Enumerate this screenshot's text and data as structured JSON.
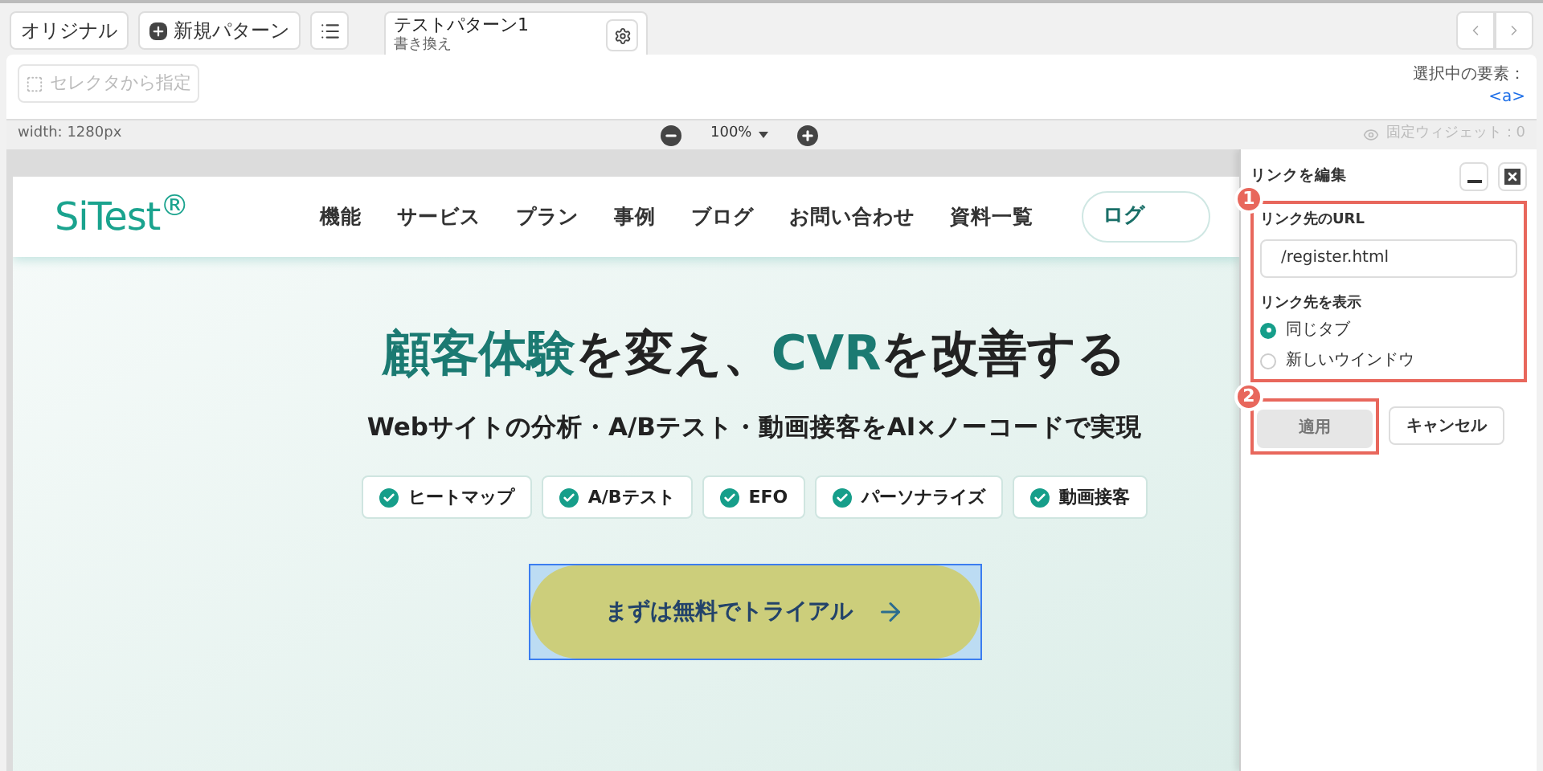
{
  "toolbar": {
    "original_button": "オリジナル",
    "new_pattern_button": "新規パターン",
    "pattern_tab": {
      "title": "テストパターン1",
      "subtitle": "書き換え",
      "selected": true
    }
  },
  "selector_bar": {
    "selector_button": {
      "label": "セレクタから指定",
      "disabled": true
    },
    "selected_element_label": "選択中の要素：",
    "selected_element": "<a>"
  },
  "zoom_bar": {
    "width_label": "width: 1280px",
    "zoom": "100%",
    "fixed_widgets": "固定ウィジェット：0"
  },
  "site": {
    "logo": "SiTest$^{®}$",
    "nav": [
      "機能",
      "サービス",
      "プラン",
      "事例",
      "ブログ",
      "お問い合わせ",
      "資料一覧"
    ],
    "login_button": "ログ",
    "headline": [
      {
        "text": "顧客体験",
        "accent": true
      },
      {
        "text": "を変え、",
        "accent": false
      },
      {
        "text": "CVR",
        "accent": true
      },
      {
        "text": "を改善する",
        "accent": false
      }
    ],
    "subheadline": "Webサイトの分析・A/Bテスト・動画接客をAI×ノーコードで実現",
    "features": [
      "ヒートマップ",
      "A/Bテスト",
      "EFO",
      "パーソナライズ",
      "動画接客"
    ],
    "cta_button": {
      "label": "まずは無料でトライアル",
      "selected": true
    }
  },
  "link_panel": {
    "title": "リンクを編集",
    "url_section": {
      "callout": "1",
      "label": "リンク先のURL",
      "value": "/register.html",
      "target_label": "リンク先を表示",
      "targets": [
        {
          "label": "同じタブ",
          "selected": true
        },
        {
          "label": "新しいウインドウ",
          "selected": false
        }
      ]
    },
    "apply_button": {
      "label": "適用",
      "callout": "2",
      "disabled": true
    },
    "cancel_button": "キャンセル"
  }
}
